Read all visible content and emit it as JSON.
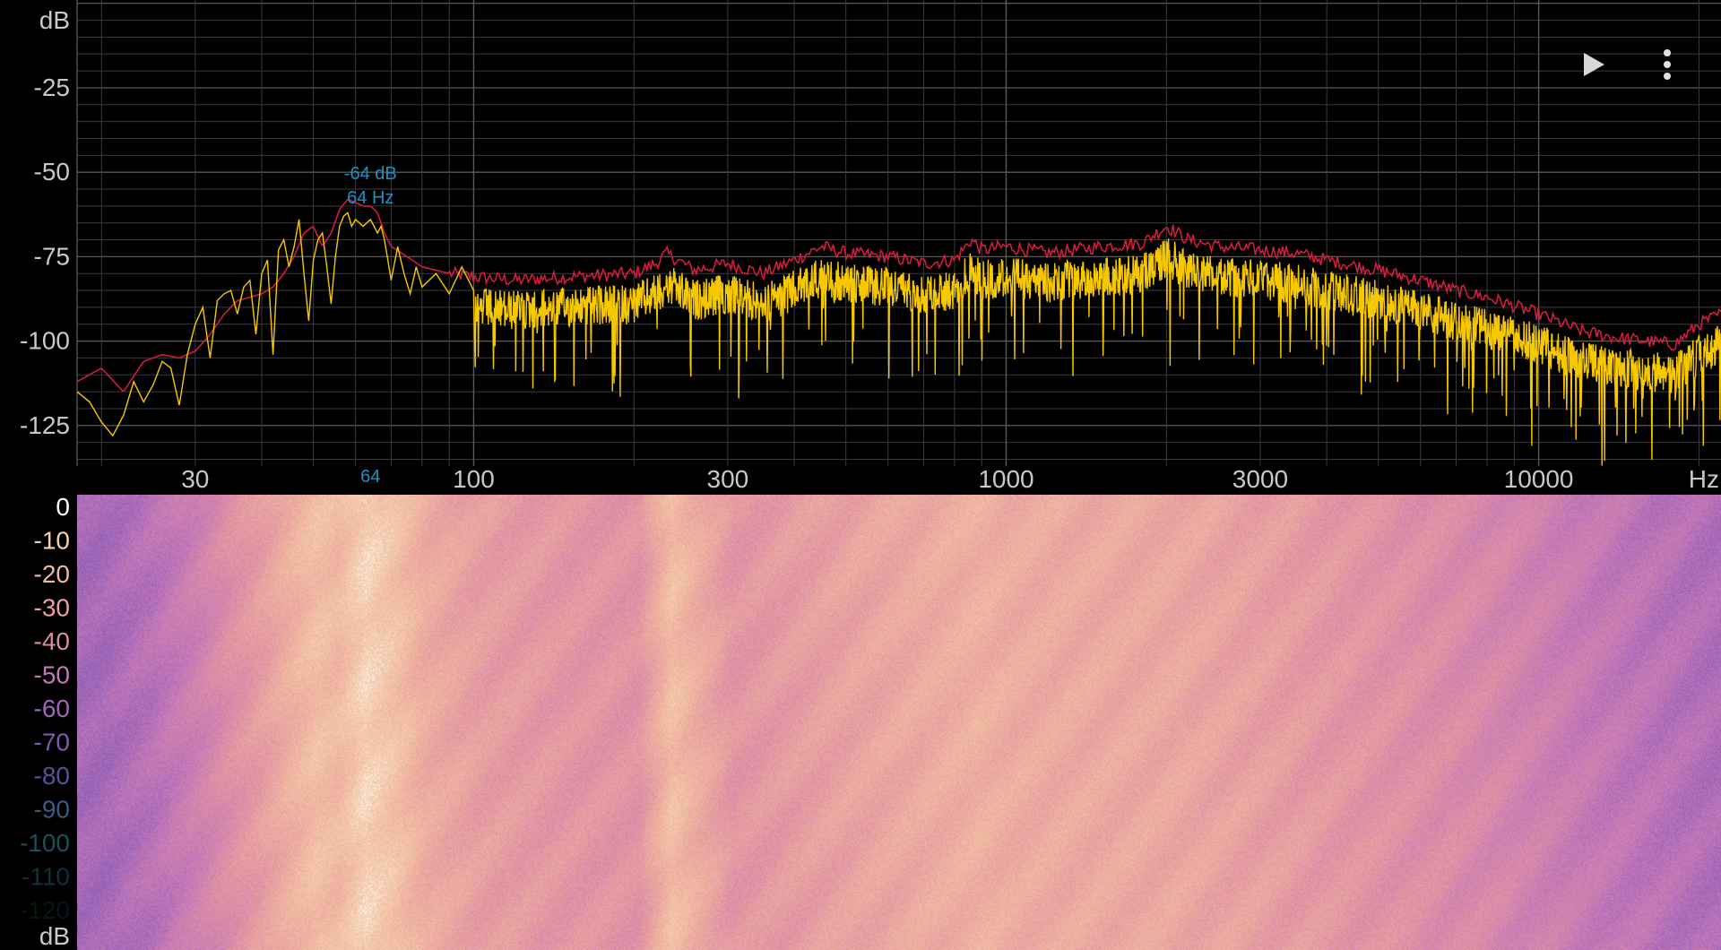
{
  "peak_marker": {
    "db_label": "-64 dB",
    "hz_label": "64 Hz",
    "axis_label": "64",
    "freq_hz": 64,
    "db": -64
  },
  "colors": {
    "background": "#000000",
    "grid": "#3a3a3a",
    "grid_major": "#5a5a5a",
    "tick_text": "#c8c8c8",
    "peak_hold": "#d21c3c",
    "spectrum": "#f5c800",
    "marker": "#1e90c8"
  },
  "icons": {
    "play": "play-icon",
    "menu": "more-vert-icon"
  },
  "chart_data": [
    {
      "type": "line",
      "title": "",
      "x_scale": "log",
      "xlim": [
        18,
        22000
      ],
      "ylim": [
        -137,
        1
      ],
      "x_unit": "Hz",
      "y_unit": "dB",
      "xticks": [
        {
          "value": 30,
          "label": "30"
        },
        {
          "value": 100,
          "label": "100"
        },
        {
          "value": 300,
          "label": "300"
        },
        {
          "value": 1000,
          "label": "1000"
        },
        {
          "value": 3000,
          "label": "3000"
        },
        {
          "value": 10000,
          "label": "10000"
        }
      ],
      "yticks": [
        {
          "value": -25,
          "label": "-25"
        },
        {
          "value": -50,
          "label": "-50"
        },
        {
          "value": -75,
          "label": "-75"
        },
        {
          "value": -100,
          "label": "-100"
        },
        {
          "value": -125,
          "label": "-125"
        }
      ],
      "grid": true,
      "series": [
        {
          "role": "peak-hold",
          "color": "#d21c3c",
          "x": [
            18,
            20,
            22,
            24,
            26,
            28,
            30,
            32,
            34,
            36,
            38,
            40,
            42,
            44,
            46,
            48,
            50,
            52,
            54,
            56,
            58,
            60,
            62,
            64,
            66,
            68,
            70,
            75,
            80,
            90,
            100,
            120,
            150,
            200,
            220,
            230,
            260,
            300,
            350,
            400,
            450,
            500,
            600,
            700,
            800,
            860,
            900,
            1000,
            1200,
            1500,
            1800,
            2000,
            2200,
            2500,
            3000,
            3500,
            4000,
            5000,
            6000,
            7000,
            8000,
            10000,
            12000,
            14000,
            16000,
            18000,
            20000,
            22000
          ],
          "y": [
            -112,
            -108,
            -115,
            -106,
            -104,
            -105,
            -103,
            -98,
            -92,
            -88,
            -87,
            -86,
            -84,
            -80,
            -75,
            -68,
            -66,
            -72,
            -68,
            -61,
            -58,
            -59,
            -60,
            -60,
            -62,
            -68,
            -72,
            -75,
            -78,
            -80,
            -81,
            -82,
            -81,
            -80,
            -77,
            -74,
            -79,
            -77,
            -80,
            -76,
            -72,
            -74,
            -75,
            -77,
            -76,
            -70,
            -73,
            -72,
            -74,
            -72,
            -71,
            -66,
            -70,
            -72,
            -73,
            -74,
            -76,
            -79,
            -82,
            -85,
            -87,
            -92,
            -97,
            -99,
            -100,
            -101,
            -95,
            -92
          ]
        },
        {
          "role": "spectrum",
          "color": "#f5c800",
          "x": [
            18,
            19,
            20,
            21,
            22,
            23,
            24,
            25,
            26,
            27,
            28,
            29,
            30,
            31,
            32,
            33,
            34,
            35,
            36,
            37,
            38,
            39,
            40,
            41,
            42,
            43,
            44,
            45,
            46,
            47,
            48,
            49,
            50,
            51,
            52,
            53,
            54,
            55,
            56,
            57,
            58,
            59,
            60,
            61,
            62,
            63,
            64,
            65,
            66,
            67,
            68,
            69,
            70,
            72,
            74,
            76,
            78,
            80,
            85,
            90,
            95,
            100
          ],
          "y": [
            -115,
            -118,
            -124,
            -128,
            -122,
            -112,
            -118,
            -113,
            -106,
            -108,
            -119,
            -104,
            -95,
            -90,
            -105,
            -88,
            -86,
            -85,
            -92,
            -84,
            -82,
            -98,
            -80,
            -76,
            -104,
            -73,
            -70,
            -78,
            -72,
            -64,
            -80,
            -94,
            -76,
            -70,
            -68,
            -78,
            -89,
            -75,
            -66,
            -63,
            -62,
            -66,
            -64,
            -65,
            -66,
            -65,
            -64,
            -66,
            -68,
            -66,
            -70,
            -76,
            -82,
            -72,
            -80,
            -86,
            -78,
            -84,
            -80,
            -86,
            -78,
            -85
          ],
          "noise_region": {
            "from_hz": 100,
            "to_hz": 22000,
            "envelope_ref": "peak-hold"
          }
        }
      ]
    },
    {
      "type": "heatmap",
      "title": "",
      "x_scale": "log",
      "xlim": [
        18,
        22000
      ],
      "x_ref": "shares frequency axis with spectrum above",
      "colorbar": {
        "unit": "dB",
        "ticks": [
          {
            "value": 0,
            "label": "0"
          },
          {
            "value": -10,
            "label": "-10"
          },
          {
            "value": -20,
            "label": "-20"
          },
          {
            "value": -30,
            "label": "-30"
          },
          {
            "value": -40,
            "label": "-40"
          },
          {
            "value": -50,
            "label": "-50"
          },
          {
            "value": -60,
            "label": "-60"
          },
          {
            "value": -70,
            "label": "-70"
          },
          {
            "value": -80,
            "label": "-80"
          },
          {
            "value": -90,
            "label": "-90"
          },
          {
            "value": -100,
            "label": "-100"
          },
          {
            "value": -110,
            "label": "-110"
          },
          {
            "value": -120,
            "label": "-120"
          }
        ],
        "colormap": [
          "#08141a",
          "#10303a",
          "#1f4d58",
          "#3a5a82",
          "#5a4f9a",
          "#7e5bb0",
          "#a066b8",
          "#c478b8",
          "#d88aa8",
          "#e8a0a0",
          "#f0b8a0",
          "#f5d0b0",
          "#ffffff"
        ]
      },
      "bands": [
        {
          "hz": 20,
          "db": -118
        },
        {
          "hz": 25,
          "db": -112
        },
        {
          "hz": 30,
          "db": -104
        },
        {
          "hz": 35,
          "db": -95
        },
        {
          "hz": 40,
          "db": -88
        },
        {
          "hz": 45,
          "db": -80
        },
        {
          "hz": 50,
          "db": -74
        },
        {
          "hz": 55,
          "db": -76
        },
        {
          "hz": 62,
          "db": -66
        },
        {
          "hz": 70,
          "db": -72
        },
        {
          "hz": 80,
          "db": -82
        },
        {
          "hz": 100,
          "db": -88
        },
        {
          "hz": 150,
          "db": -92
        },
        {
          "hz": 200,
          "db": -93
        },
        {
          "hz": 230,
          "db": -74
        },
        {
          "hz": 300,
          "db": -92
        },
        {
          "hz": 500,
          "db": -86
        },
        {
          "hz": 860,
          "db": -80
        },
        {
          "hz": 1000,
          "db": -82
        },
        {
          "hz": 2000,
          "db": -84
        },
        {
          "hz": 3000,
          "db": -88
        },
        {
          "hz": 5000,
          "db": -94
        },
        {
          "hz": 8000,
          "db": -100
        },
        {
          "hz": 12000,
          "db": -108
        },
        {
          "hz": 16000,
          "db": -112
        },
        {
          "hz": 22000,
          "db": -116
        }
      ]
    }
  ]
}
